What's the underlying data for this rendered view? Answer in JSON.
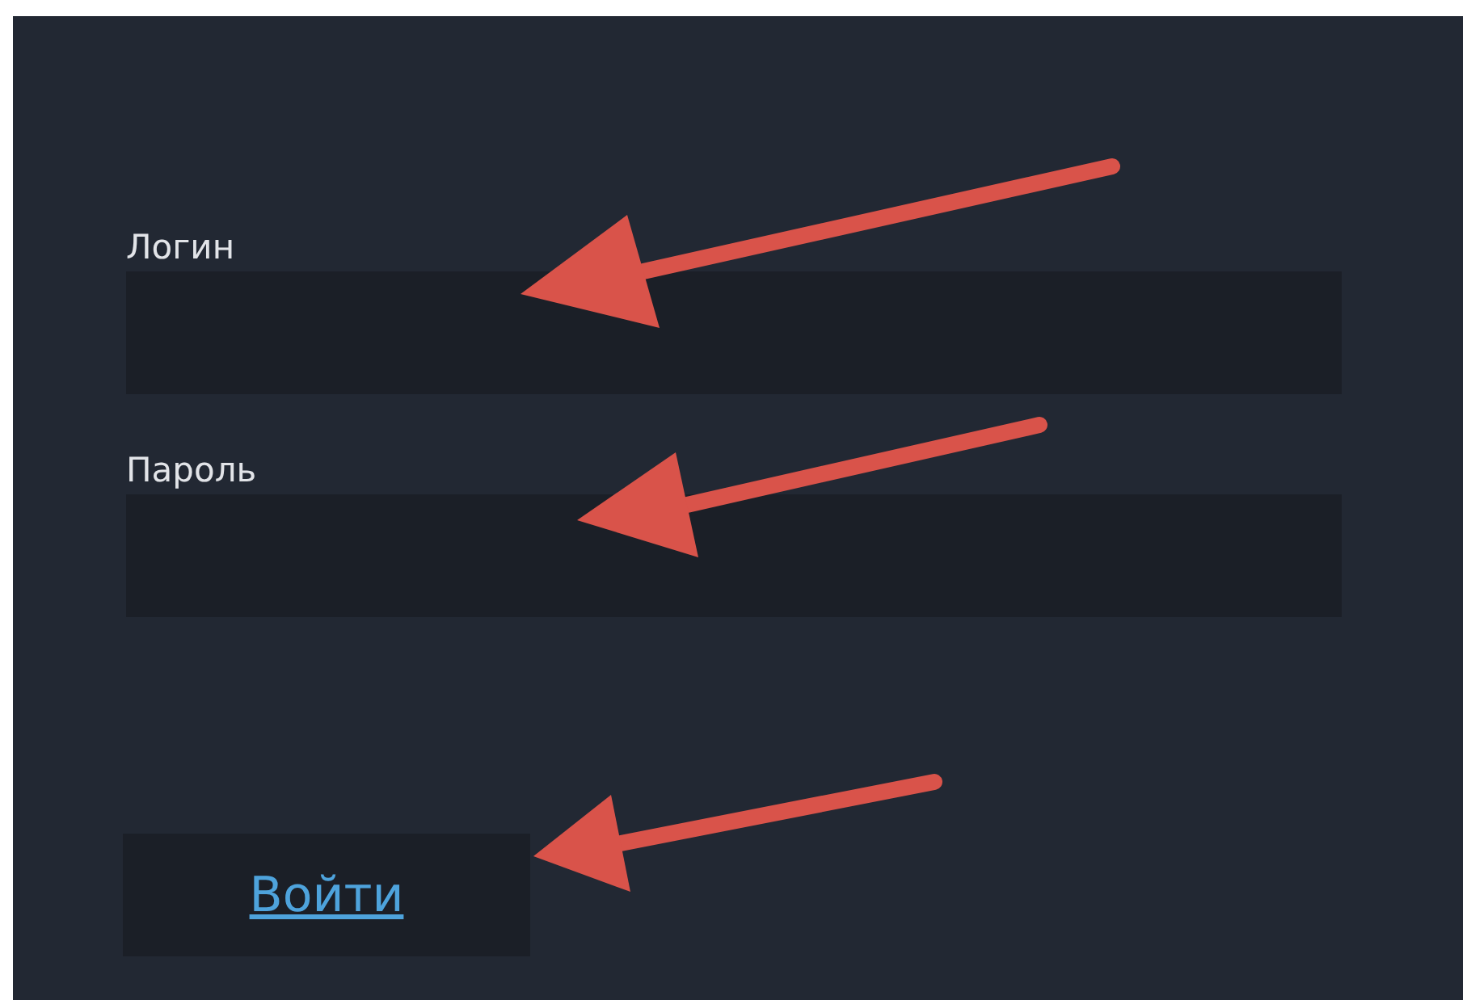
{
  "form": {
    "fields": [
      {
        "label": "Логин"
      },
      {
        "label": "Пароль"
      }
    ],
    "button": "Войти"
  }
}
